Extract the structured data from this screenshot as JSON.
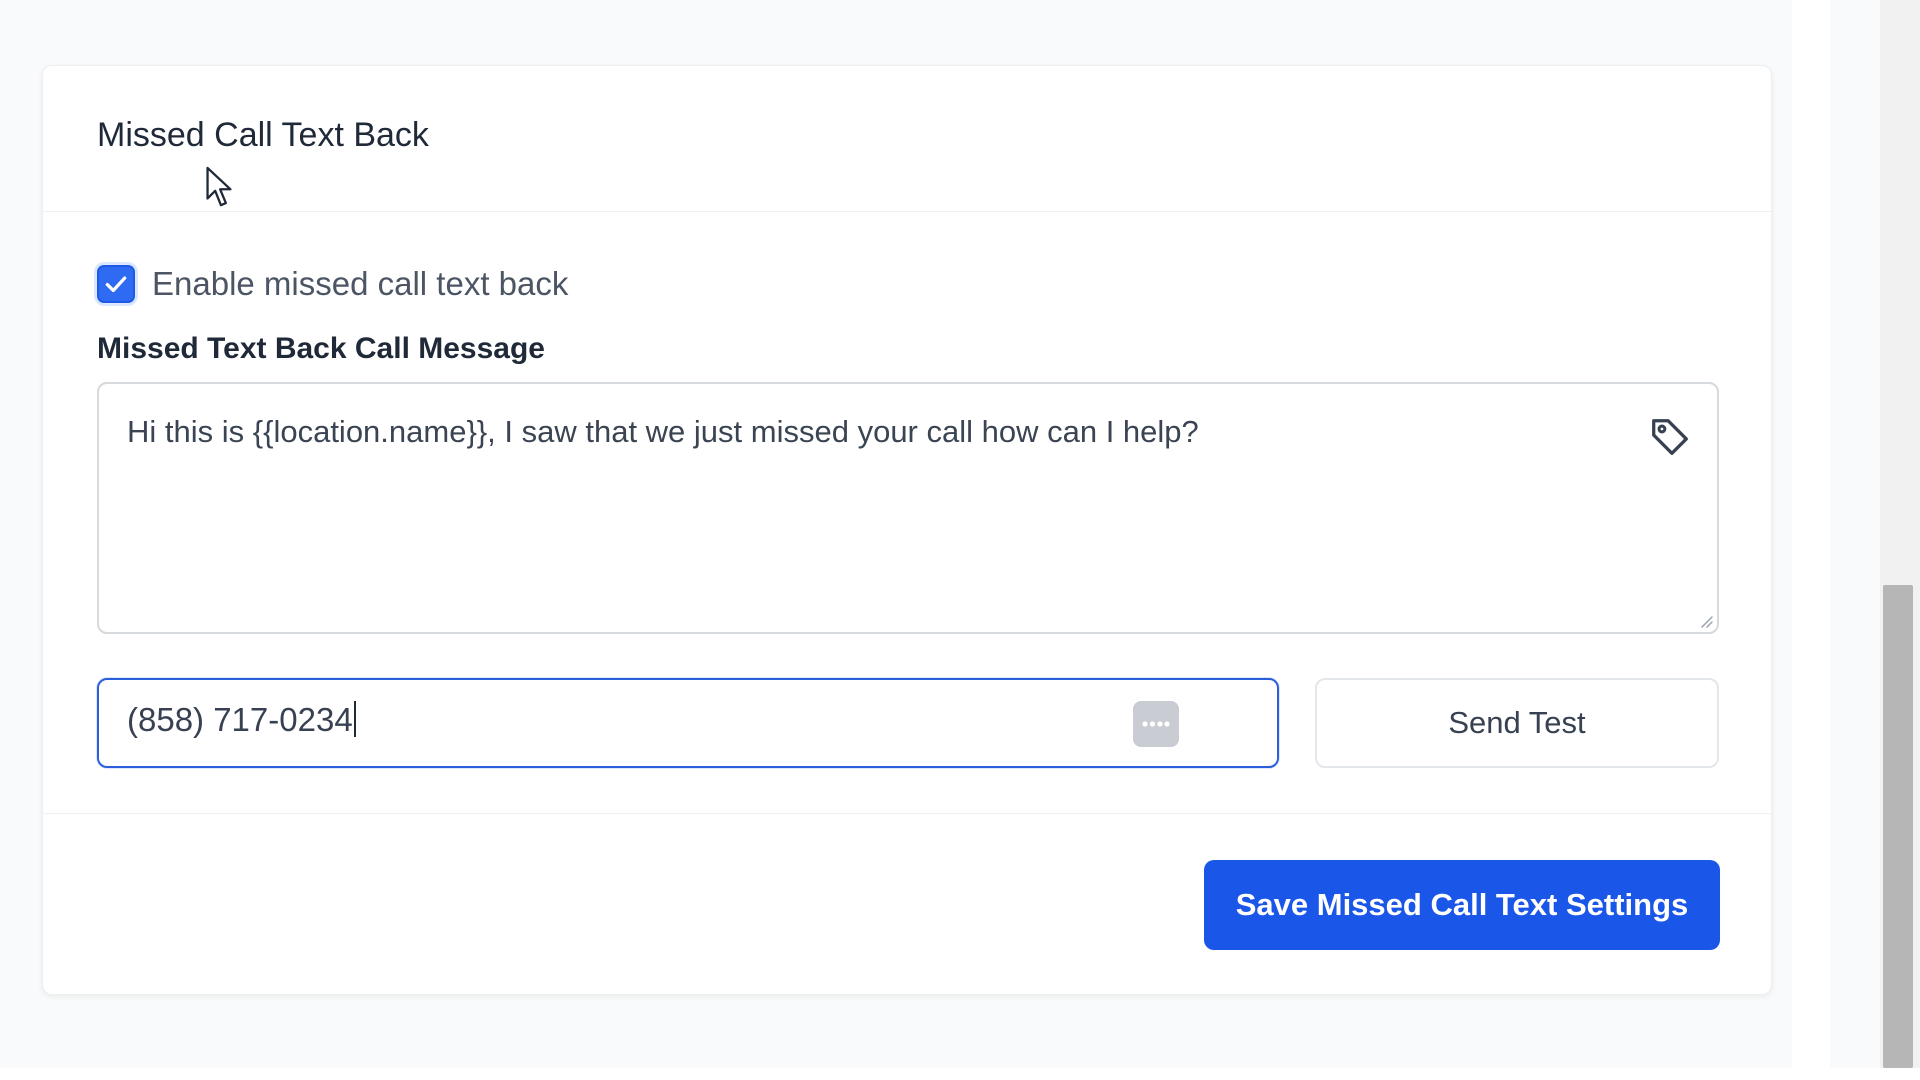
{
  "card": {
    "title": "Missed Call Text Back"
  },
  "enable_checkbox": {
    "label": "Enable missed call text back",
    "checked": true
  },
  "message": {
    "label": "Missed Text Back Call Message",
    "value": "Hi this is {{location.name}}, I saw that we just missed your call how can I help?"
  },
  "test": {
    "phone_value": "(858) 717-0234",
    "send_label": "Send Test"
  },
  "footer": {
    "save_label": "Save Missed Call Text Settings"
  },
  "icons": {
    "checkbox": "check-icon",
    "tag": "tag-icon",
    "autofill": "autofill-key-icon",
    "resize": "resize-grip-icon",
    "cursor": "mouse-pointer-icon"
  },
  "colors": {
    "primary": "#1a56e8",
    "focus_border": "#2b5fd9",
    "checkbox": "#2f6bf2"
  }
}
